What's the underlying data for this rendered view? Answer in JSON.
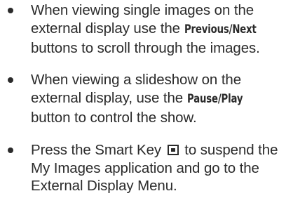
{
  "bullets": [
    {
      "text_before": "When viewing single images on the external display use the ",
      "bold": "Previous/Next",
      "text_after": " buttons to scroll through the images."
    },
    {
      "text_before": "When viewing a slideshow on the external display, use the ",
      "bold": "Pause/Play",
      "text_after": " button to control the show."
    },
    {
      "text_before": "Press the Smart Key ",
      "icon": "smart-key-icon",
      "text_after": " to suspend the My Images application and go to the External Display Menu."
    }
  ]
}
